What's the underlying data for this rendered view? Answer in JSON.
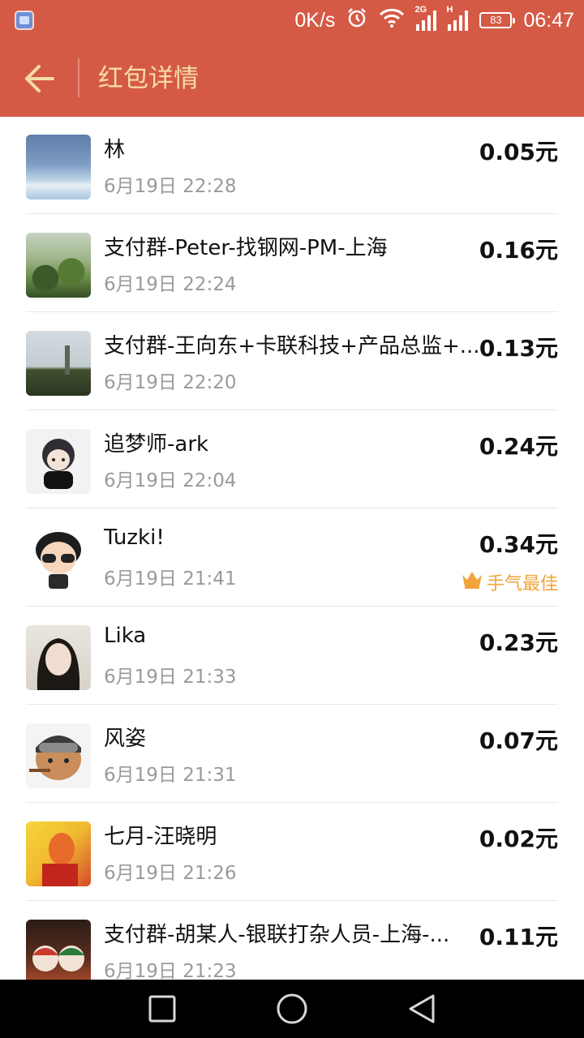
{
  "status_bar": {
    "speed": "0K/s",
    "network_2g": "2G",
    "network_h": "H",
    "battery": "83",
    "time": "06:47"
  },
  "header": {
    "title": "红包详情",
    "back_icon": "arrow-left-icon"
  },
  "records": [
    {
      "name": "林",
      "date": "6月19日  22:28",
      "amount": "0.05元",
      "best": ""
    },
    {
      "name": "支付群-Peter-找钢网-PM-上海",
      "date": "6月19日  22:24",
      "amount": "0.16元",
      "best": ""
    },
    {
      "name": "支付群-王向东+卡联科技+产品总监+...",
      "date": "6月19日  22:20",
      "amount": "0.13元",
      "best": ""
    },
    {
      "name": "追梦师-ark",
      "date": "6月19日  22:04",
      "amount": "0.24元",
      "best": ""
    },
    {
      "name": "Tuzki!",
      "date": "6月19日  21:41",
      "amount": "0.34元",
      "best": "手气最佳"
    },
    {
      "name": "Lika",
      "date": "6月19日  21:33",
      "amount": "0.23元",
      "best": ""
    },
    {
      "name": "风姿",
      "date": "6月19日  21:31",
      "amount": "0.07元",
      "best": ""
    },
    {
      "name": "七月-汪晓明",
      "date": "6月19日  21:26",
      "amount": "0.02元",
      "best": ""
    },
    {
      "name": "支付群-胡某人-银联打杂人员-上海-...",
      "date": "6月19日  21:23",
      "amount": "0.11元",
      "best": ""
    }
  ],
  "colors": {
    "header_bg": "#d55a45",
    "title_color": "#f6dca8",
    "best_color": "#f0a43a"
  },
  "nav_bar": {
    "recent": "square-icon",
    "home": "circle-icon",
    "back": "triangle-back-icon"
  }
}
